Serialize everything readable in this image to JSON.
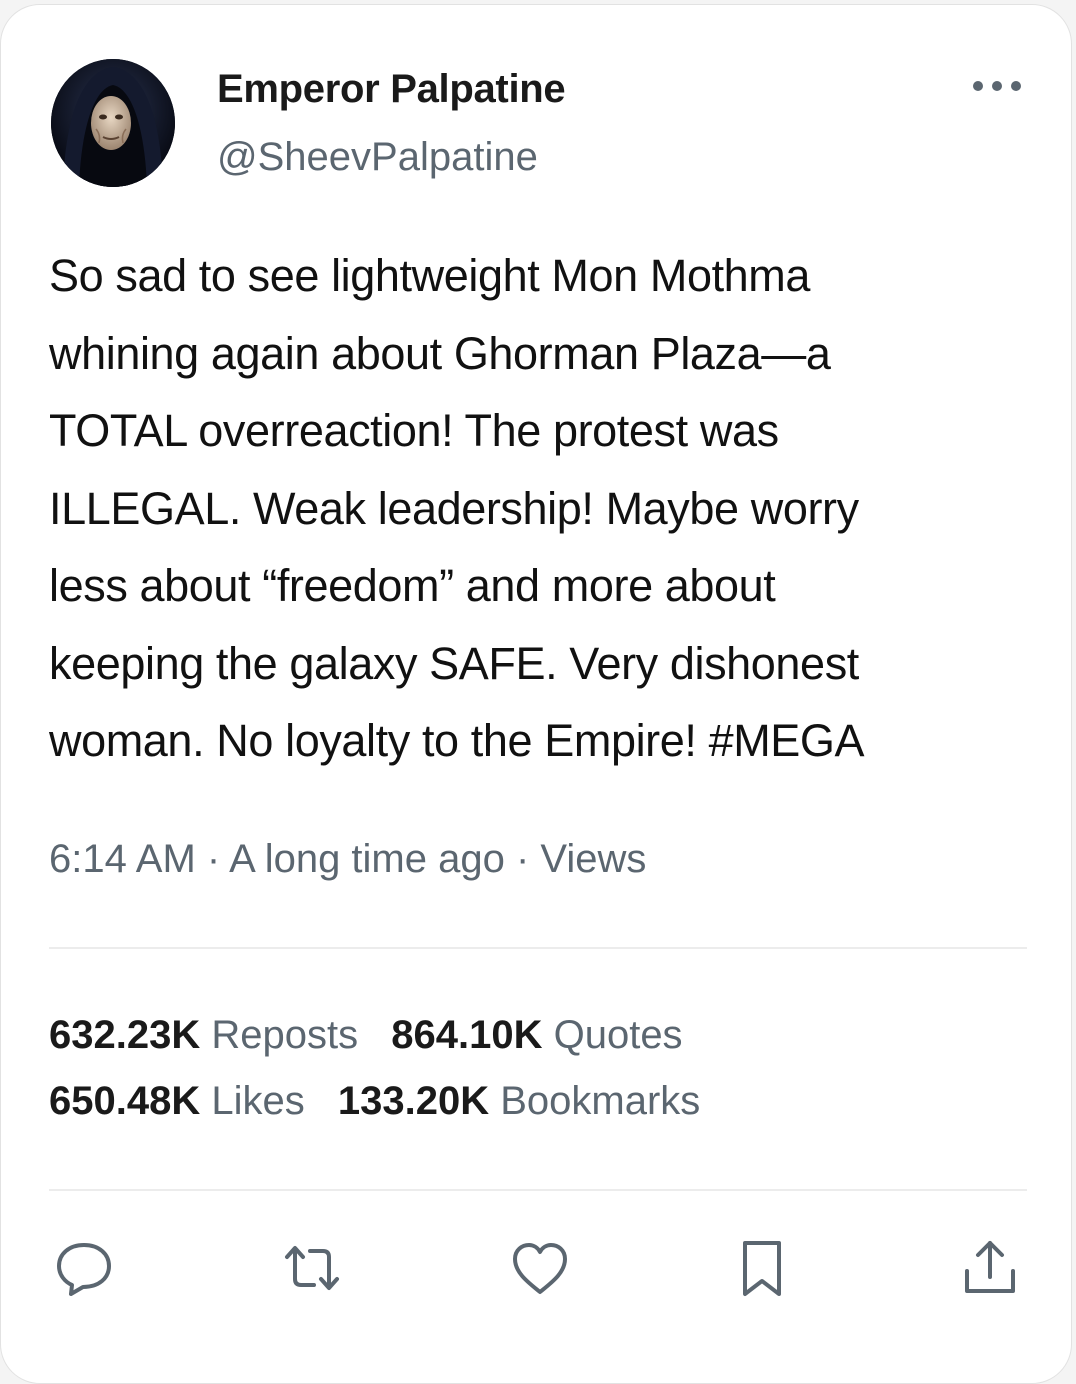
{
  "author": {
    "name": "Emperor Palpatine",
    "handle": "@SheevPalpatine",
    "avatar_icon": "hooded-emperor-avatar"
  },
  "tweet": {
    "lines": [
      "So sad to see lightweight Mon Mothma",
      "whining again about Ghorman Plaza—a",
      "TOTAL overreaction! The protest was",
      "ILLEGAL. Weak leadership! Maybe worry",
      "less about “freedom” and more about",
      "keeping the galaxy SAFE. Very dishonest",
      "woman. No loyalty to the Empire! #MEGA"
    ]
  },
  "meta": {
    "time": "6:14 AM",
    "separator": " · ",
    "date": "A long time ago",
    "views_label": "Views"
  },
  "stats": {
    "reposts": {
      "count": "632.23K",
      "label": "Reposts"
    },
    "quotes": {
      "count": "864.10K",
      "label": "Quotes"
    },
    "likes": {
      "count": "650.48K",
      "label": "Likes"
    },
    "bookmarks": {
      "count": "133.20K",
      "label": "Bookmarks"
    }
  },
  "actions": {
    "icons": [
      "reply-icon",
      "repost-icon",
      "like-icon",
      "bookmark-icon",
      "share-icon"
    ]
  },
  "colors": {
    "text": "#111111",
    "secondary": "#5b6670",
    "icon": "#5b6670",
    "divider": "#ececec"
  }
}
